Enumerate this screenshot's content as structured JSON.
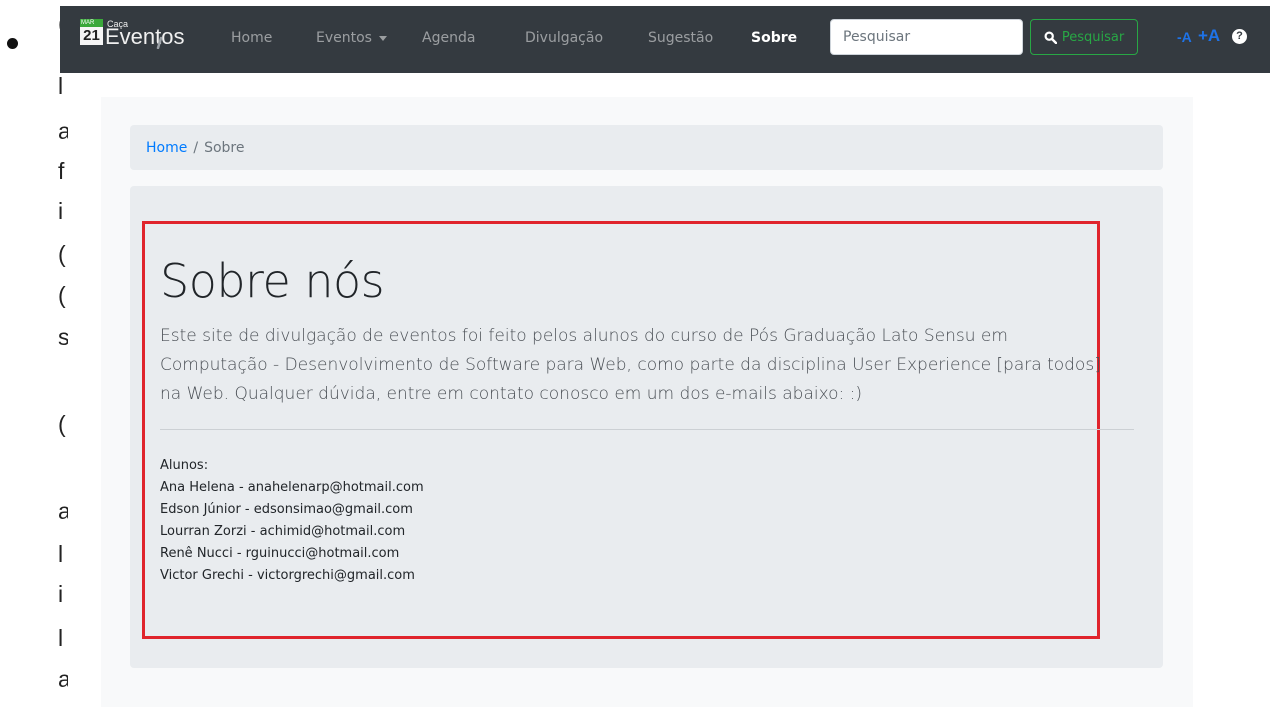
{
  "doc": {
    "chars": [
      "(",
      "l",
      "a",
      "f",
      "i",
      "(",
      "(",
      "s",
      "(",
      "a",
      "l",
      "i",
      "l",
      "a"
    ]
  },
  "navbar": {
    "logo": {
      "calendar_month": "MAR",
      "calendar_day": "21",
      "small_text": "Caça",
      "big_text": "Eventos"
    },
    "links": [
      {
        "label": "Home"
      },
      {
        "label": "Eventos"
      },
      {
        "label": "Agenda"
      },
      {
        "label": "Divulgação"
      },
      {
        "label": "Sugestão"
      },
      {
        "label": "Sobre"
      }
    ],
    "search": {
      "placeholder": "Pesquisar",
      "button_label": "Pesquisar"
    },
    "font_decrease": "-A",
    "font_increase": "+A",
    "help_symbol": "?"
  },
  "breadcrumb": {
    "home": "Home",
    "separator": "/",
    "current": "Sobre"
  },
  "main": {
    "title": "Sobre nós",
    "lead": "Este site de divulgação de eventos foi feito pelos alunos do curso de Pós Graduação Lato Sensu em Computação - Desenvolvimento de Software para Web, como parte da disciplina User Experience [para todos] na Web. Qualquer dúvida, entre em contato conosco em um dos e-mails abaixo: :)",
    "students_label": "Alunos:",
    "students": [
      "Ana Helena - anahelenarp@hotmail.com",
      "Edson Júnior - edsonsimao@gmail.com",
      "Lourran Zorzi - achimid@hotmail.com",
      "Renê Nucci - rguinucci@hotmail.com",
      "Victor Grechi - victorgrechi@gmail.com"
    ]
  },
  "colors": {
    "navbar_bg": "#343a40",
    "accent_green": "#28a745",
    "link_blue": "#007bff",
    "font_size_blue": "#1e73e8",
    "highlight_red": "#e0242c",
    "jumbotron_bg": "#e9ecef"
  }
}
